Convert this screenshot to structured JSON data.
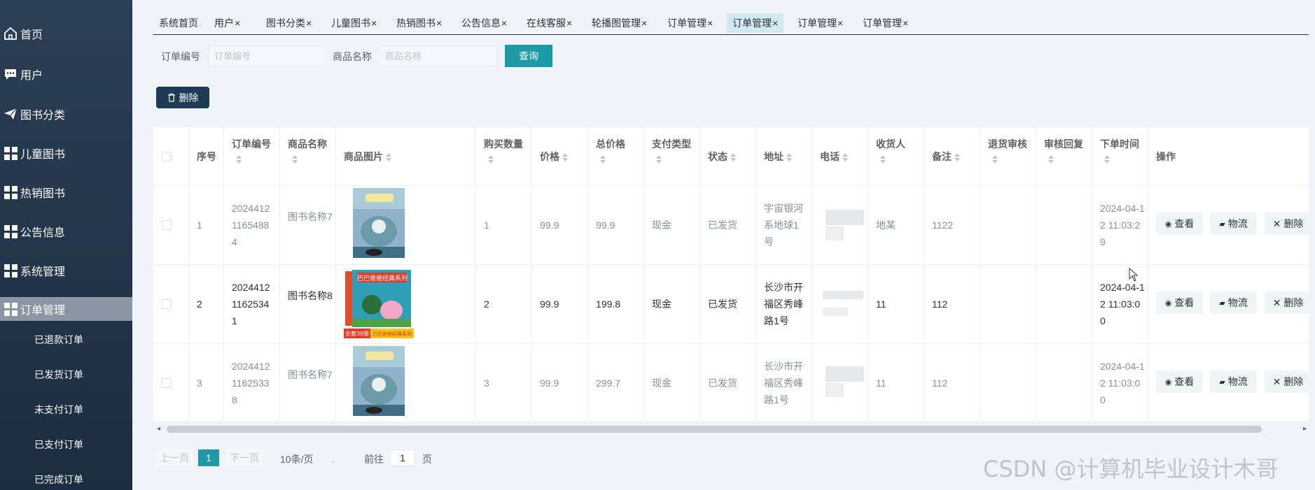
{
  "sidebar": {
    "items": [
      {
        "label": "首页",
        "icon": "home-icon"
      },
      {
        "label": "用户",
        "icon": "chat-icon"
      },
      {
        "label": "图书分类",
        "icon": "send-icon"
      },
      {
        "label": "儿童图书",
        "icon": "grid-icon"
      },
      {
        "label": "热销图书",
        "icon": "grid-icon"
      },
      {
        "label": "公告信息",
        "icon": "grid-icon"
      },
      {
        "label": "系统管理",
        "icon": "grid-icon"
      },
      {
        "label": "订单管理",
        "icon": "grid-icon",
        "active": true
      }
    ],
    "sub_items": [
      "已退款订单",
      "已发货订单",
      "未支付订单",
      "已支付订单",
      "已完成订单"
    ]
  },
  "tabs": [
    {
      "label": "系统首页",
      "closable": false
    },
    {
      "label": "用户",
      "closable": true
    },
    {
      "label": "图书分类",
      "closable": true
    },
    {
      "label": "儿童图书",
      "closable": true
    },
    {
      "label": "热销图书",
      "closable": true
    },
    {
      "label": "公告信息",
      "closable": true
    },
    {
      "label": "在线客服",
      "closable": true
    },
    {
      "label": "轮播图管理",
      "closable": true
    },
    {
      "label": "订单管理",
      "closable": true
    },
    {
      "label": "订单管理",
      "closable": true,
      "active": true
    },
    {
      "label": "订单管理",
      "closable": true
    },
    {
      "label": "订单管理",
      "closable": true
    }
  ],
  "tab_close_glyph": "×",
  "search": {
    "order_no_label": "订单编号",
    "order_no_placeholder": "订单编号",
    "product_label": "商品名称",
    "product_placeholder": "商品名称",
    "query_label": "查询"
  },
  "toolbar": {
    "delete_label": "删除"
  },
  "table": {
    "headers": {
      "index": "序号",
      "order_no": "订单编号",
      "product_name": "商品名称",
      "product_image": "商品图片",
      "quantity": "购买数量",
      "price": "价格",
      "total": "总价格",
      "pay_type": "支付类型",
      "status": "状态",
      "address": "地址",
      "phone": "电话",
      "receiver": "收货人",
      "remark": "备注",
      "refund_review": "退货审核",
      "review_reply": "审核回复",
      "order_time": "下单时间",
      "actions": "操作"
    },
    "rows": [
      {
        "index": "1",
        "order_no": "20244121165488 4",
        "product_name": "图书名称7",
        "quantity": "1",
        "price": "99.9",
        "total": "99.9",
        "pay_type": "现金",
        "status": "已发货",
        "address": "宇宙银河系地球1号",
        "receiver": "地某",
        "remark": "1122",
        "order_time": "2024-04-12 11:03:29"
      },
      {
        "index": "2",
        "order_no": "20244121162534 1",
        "product_name": "图书名称8",
        "quantity": "2",
        "price": "99.9",
        "total": "199.8",
        "pay_type": "现金",
        "status": "已发货",
        "address": "长沙市开福区秀峰路1号",
        "receiver": "11",
        "remark": "112",
        "order_time": "2024-04-12 11:03:00"
      },
      {
        "index": "3",
        "order_no": "20244121162533 8",
        "product_name": "图书名称7",
        "quantity": "3",
        "price": "99.9",
        "total": "299.7",
        "pay_type": "现金",
        "status": "已发货",
        "address": "长沙市开福区秀峰路1号",
        "receiver": "11",
        "remark": "112",
        "order_time": "2024-04-12 11:03:00"
      }
    ],
    "row_actions": {
      "view": "查看",
      "logistics": "物流",
      "delete": "删除"
    },
    "image_texts": {
      "series_title": "巴巴爸爸经典系列",
      "banner": "全套30册"
    }
  },
  "pagination": {
    "prev": "上一页",
    "current": "1",
    "next": "下一页",
    "page_size": "10条/页",
    "goto_prefix": "前往",
    "goto_value": "1",
    "goto_suffix": "页"
  },
  "watermark": "CSDN @计算机毕业设计木哥",
  "colors": {
    "accent": "#1d9aa6",
    "sidebar": "#223548",
    "dark_button": "#1f3a54"
  }
}
